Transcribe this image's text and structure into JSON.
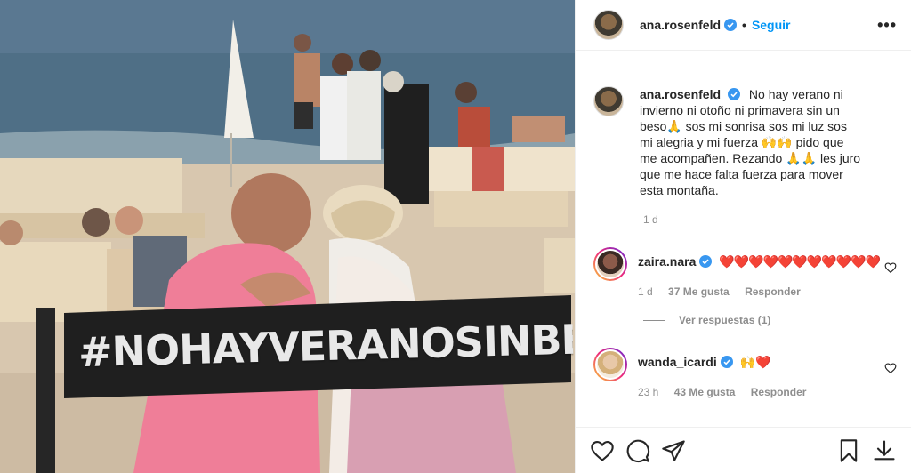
{
  "post": {
    "photo_banner": "#NOHAYVERANOSINBESO",
    "author": {
      "username": "ana.rosenfeld",
      "verified": true,
      "follow_label": "Seguir",
      "more_label": "•••"
    },
    "caption": {
      "username": "ana.rosenfeld",
      "text": "No hay verano ni invierno ni otoño ni primavera sin un beso🙏 sos mi sonrisa sos mi luz sos mi alegria y mi fuerza 🙌🙌 pido que me acompañen. Rezando 🙏🙏 les juro que me hace falta fuerza para mover esta montaña.",
      "time": "1 d"
    },
    "comments": [
      {
        "username": "zaira.nara",
        "verified": true,
        "text": "❤️❤️❤️❤️❤️❤️❤️❤️❤️❤️❤️",
        "time": "1 d",
        "likes": "37 Me gusta",
        "reply_label": "Responder",
        "view_replies": "Ver respuestas (1)"
      },
      {
        "username": "wanda_icardi",
        "verified": true,
        "text": "🙌❤️",
        "time": "23 h",
        "likes": "43 Me gusta",
        "reply_label": "Responder"
      }
    ]
  },
  "colors": {
    "link": "#0095f6",
    "verified": "#3897f0",
    "heart": "#ed4956",
    "muted": "#8e8e8e"
  },
  "icons": [
    "heart-icon",
    "comment-icon",
    "share-icon",
    "bookmark-icon",
    "download-icon",
    "more-icon",
    "verified-badge-icon"
  ]
}
